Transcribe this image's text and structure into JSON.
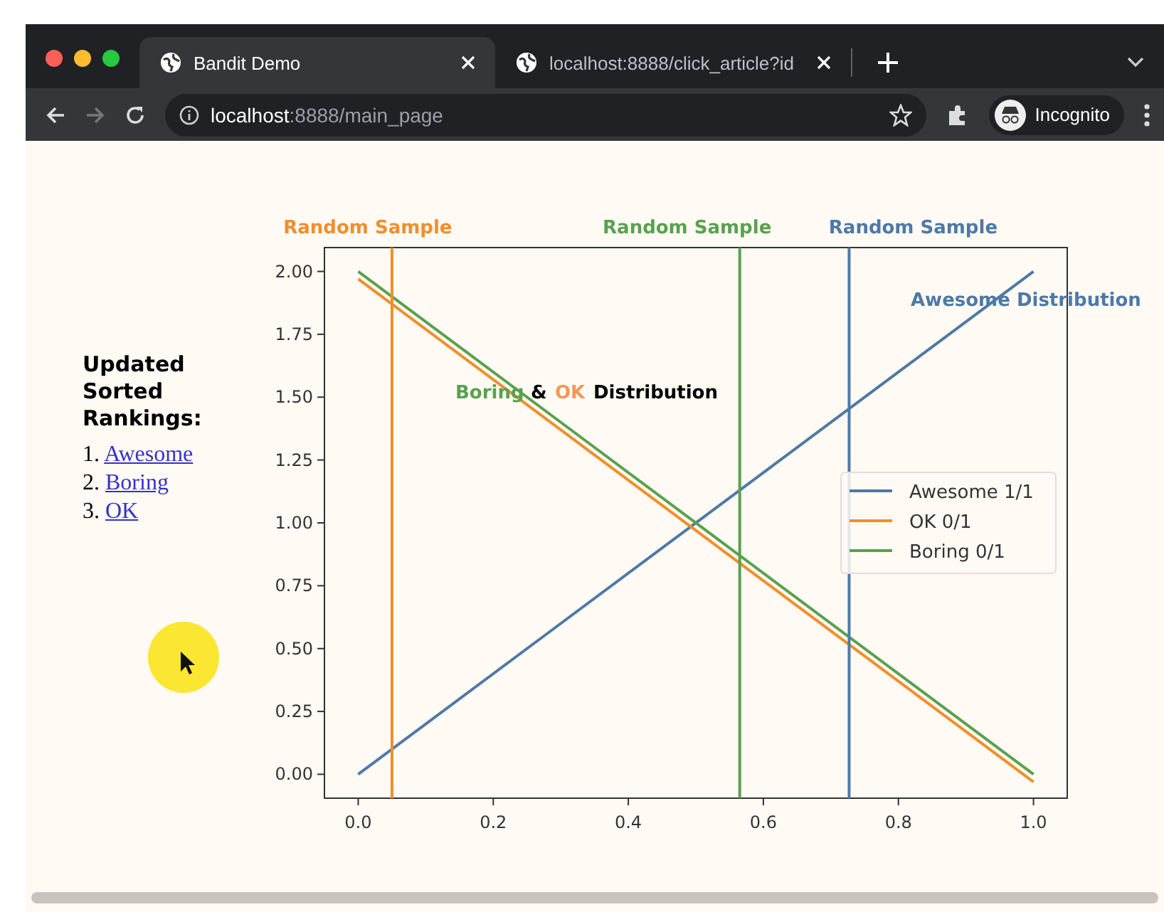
{
  "browser": {
    "tabs": [
      {
        "title": "Bandit Demo",
        "selected": true
      },
      {
        "title": "localhost:8888/click_article?id",
        "selected": false
      }
    ],
    "address": {
      "host": "localhost",
      "rest": ":8888/main_page"
    },
    "profile": "Incognito"
  },
  "sidebar": {
    "heading": "Updated Sorted Rankings:",
    "links": [
      {
        "marker": "1.",
        "label": "Awesome"
      },
      {
        "marker": "2.",
        "label": "Boring"
      },
      {
        "marker": "3.",
        "label": "OK"
      }
    ]
  },
  "chart_data": {
    "type": "line",
    "x": [
      0,
      1
    ],
    "xlim": [
      -0.05,
      1.05
    ],
    "ylim": [
      -0.095,
      2.095
    ],
    "xticks": [
      {
        "value": 0,
        "label": "0.0"
      },
      {
        "value": 0.2,
        "label": "0.2"
      },
      {
        "value": 0.4,
        "label": "0.4"
      },
      {
        "value": 0.6,
        "label": "0.6"
      },
      {
        "value": 0.8,
        "label": "0.8"
      },
      {
        "value": 1,
        "label": "1.0"
      }
    ],
    "yticks": [
      {
        "value": 0,
        "label": "0.00"
      },
      {
        "value": 0.25,
        "label": "0.25"
      },
      {
        "value": 0.5,
        "label": "0.50"
      },
      {
        "value": 0.75,
        "label": "0.75"
      },
      {
        "value": 1,
        "label": "1.00"
      },
      {
        "value": 1.25,
        "label": "1.25"
      },
      {
        "value": 1.5,
        "label": "1.50"
      },
      {
        "value": 1.75,
        "label": "1.75"
      },
      {
        "value": 2,
        "label": "2.00"
      }
    ],
    "series": [
      {
        "name": "Awesome 1/1",
        "color": "#4e79a7",
        "values": [
          0,
          2
        ]
      },
      {
        "name": "OK 0/1",
        "color": "#f28e2b",
        "values": [
          1.97,
          -0.03
        ]
      },
      {
        "name": "Boring 0/1",
        "color": "#59a14f",
        "values": [
          2,
          0
        ]
      }
    ],
    "legend": true,
    "ref_lines": [
      {
        "axis": "x",
        "value": 0.05,
        "color": "#f28e2b",
        "label": "Random Sample"
      },
      {
        "axis": "x",
        "value": 0.565,
        "color": "#59a14f",
        "label": "Random Sample"
      },
      {
        "axis": "x",
        "value": 0.727,
        "color": "#4e79a7",
        "label": "Random Sample"
      }
    ]
  },
  "chart_labels": [
    {
      "text": "Awesome Distribution",
      "color": "#4e79a7"
    },
    {
      "text": "Boring",
      "color": "#59a14f"
    },
    {
      "text": "&",
      "color": "#000000"
    },
    {
      "text": "OK",
      "color": "#f0995a"
    },
    {
      "text": "Distribution",
      "color": "#000000"
    }
  ]
}
